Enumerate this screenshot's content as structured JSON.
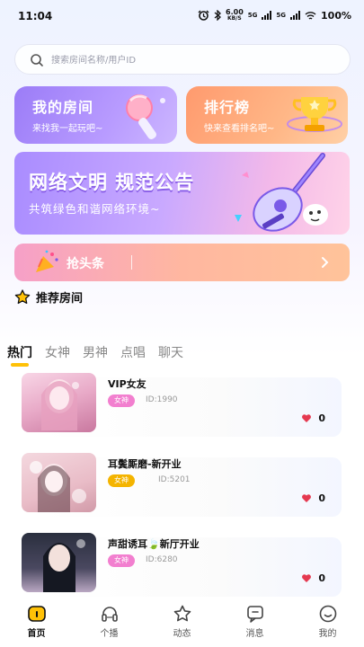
{
  "status_bar": {
    "time": "11:04",
    "net_speed_value": "6.00",
    "net_speed_unit": "KB/S",
    "net_type_1": "5G",
    "net_type_2": "5G",
    "battery": "100%"
  },
  "search": {
    "placeholder": "搜索房间名称/用户ID"
  },
  "cards": [
    {
      "title": "我的房间",
      "subtitle": "来找我一起玩吧~"
    },
    {
      "title": "排行榜",
      "subtitle": "快来查看排名吧~"
    }
  ],
  "banner": {
    "title": "网络文明 规范公告",
    "subtitle": "共筑绿色和谐网络环境~"
  },
  "headline": {
    "label": "抢头条"
  },
  "recommend": {
    "title": "推荐房间"
  },
  "tabs": [
    "热门",
    "女神",
    "男神",
    "点唱",
    "聊天"
  ],
  "active_tab": "热门",
  "rooms": [
    {
      "name": "VIP女友",
      "tag": "女神",
      "id": "ID:1990",
      "likes": "0",
      "tag_color": "#f27fcf"
    },
    {
      "name": "耳鬓厮磨-新开业",
      "tag": "女神",
      "id": "ID:5201",
      "likes": "0",
      "tag_color": "#f4b400"
    },
    {
      "name": "声甜诱耳🍃新厅开业",
      "tag": "女神",
      "id": "ID:6280",
      "likes": "0",
      "tag_color": "#f27fcf"
    }
  ],
  "nav": [
    {
      "label": "首页",
      "icon": "home-icon",
      "active": true
    },
    {
      "label": "个播",
      "icon": "headphones-icon",
      "active": false
    },
    {
      "label": "动态",
      "icon": "star-icon",
      "active": false
    },
    {
      "label": "消息",
      "icon": "message-icon",
      "active": false
    },
    {
      "label": "我的",
      "icon": "smile-icon",
      "active": false
    }
  ],
  "colors": {
    "accent": "#ffc107",
    "purple": "#9b7cf7",
    "orange": "#ff9a6e",
    "heart": "#e53950"
  }
}
